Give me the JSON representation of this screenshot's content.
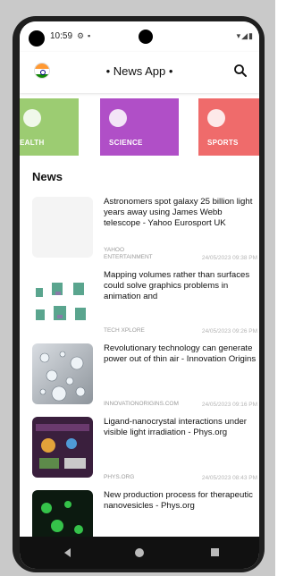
{
  "status_bar": {
    "time": "10:59",
    "left_icons": [
      "settings-icon",
      "notification-icon"
    ],
    "right_icons": "▾◢▮"
  },
  "app_bar": {
    "title": "• News App •",
    "flag_icon": "india-flag-icon",
    "search_icon": "search-icon"
  },
  "categories": [
    {
      "label": "EALTH",
      "color": "#9ccc72",
      "icon": "health-icon"
    },
    {
      "label": "SCIENCE",
      "color": "#b04fc7",
      "icon": "science-icon"
    },
    {
      "label": "SPORTS",
      "color": "#ef6b6b",
      "icon": "sports-icon"
    }
  ],
  "news": {
    "heading": "News",
    "items": [
      {
        "headline": "Astronomers spot galaxy 25 billion light years away using James Webb telescope - Yahoo Eurosport UK",
        "source": "YAHOO ENTERTAINMENT",
        "date": "24/05/2023 09:38 PM"
      },
      {
        "headline": "Mapping volumes rather than surfaces could solve graphics problems in animation and",
        "source": "TECH XPLORE",
        "date": "24/05/2023 09:26 PM"
      },
      {
        "headline": "Revolutionary technology can generate power out of thin air - Innovation Origins",
        "source": "INNOVATIONORIGINS.COM",
        "date": "24/05/2023 09:16 PM"
      },
      {
        "headline": "Ligand-nanocrystal interactions under visible light irradiation - Phys.org",
        "source": "PHYS.ORG",
        "date": "24/05/2023 08:43 PM"
      },
      {
        "headline": "New production process for therapeutic nanovesicles - Phys.org",
        "source": "",
        "date": ""
      }
    ]
  },
  "nav_bar": {
    "back_icon": "back-icon",
    "home_icon": "home-icon",
    "recents_icon": "recents-icon"
  }
}
